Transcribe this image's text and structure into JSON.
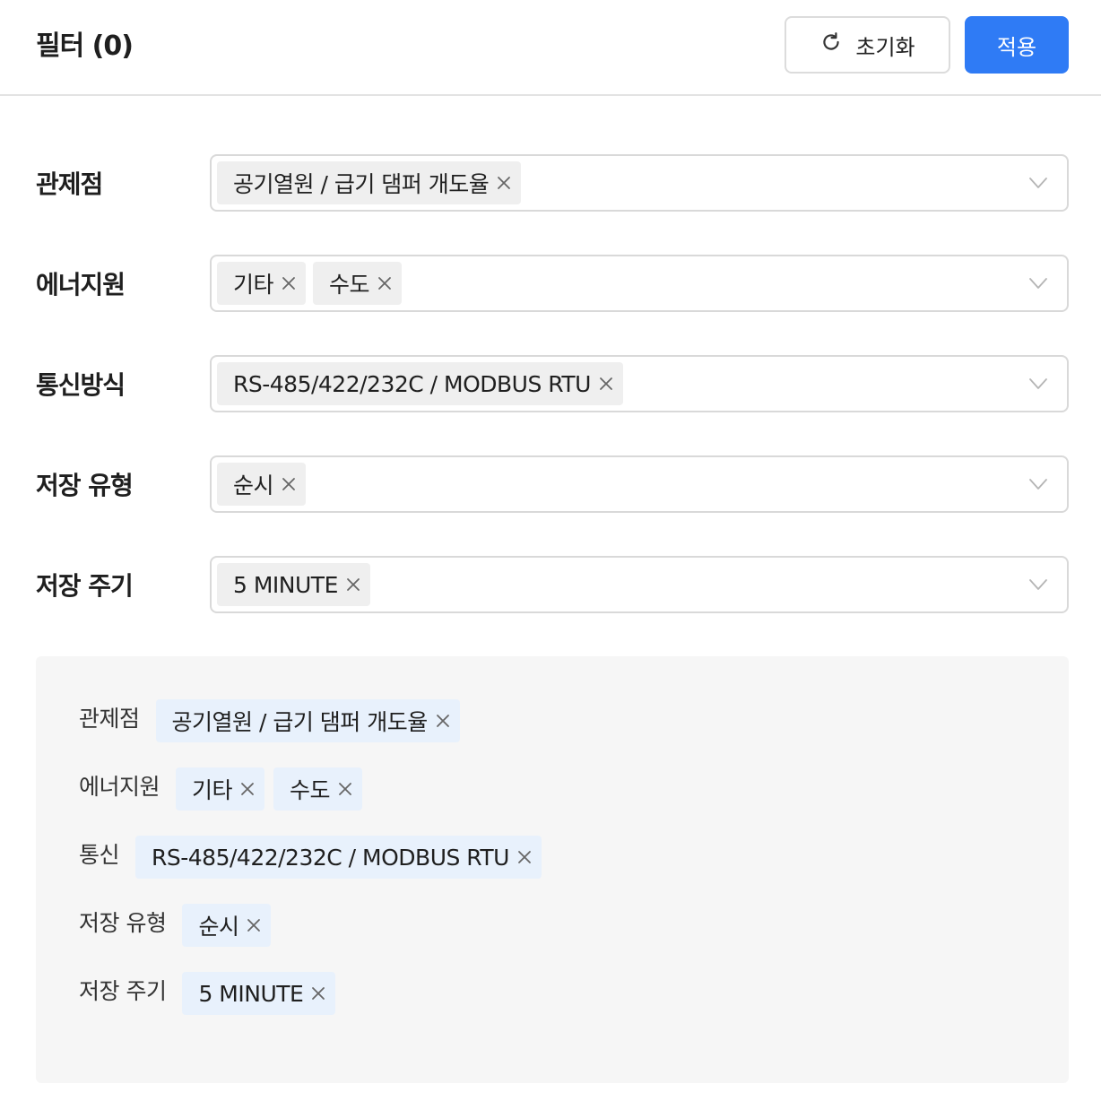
{
  "header": {
    "title": "필터 (0)",
    "reset_label": "초기화",
    "apply_label": "적용",
    "apply_color": "#2f7bf5"
  },
  "filters": [
    {
      "label": "관제점",
      "tags": [
        "공기열원 / 급기 댐퍼 개도율"
      ]
    },
    {
      "label": "에너지원",
      "tags": [
        "기타",
        "수도"
      ]
    },
    {
      "label": "통신방식",
      "tags": [
        "RS-485/422/232C / MODBUS RTU"
      ]
    },
    {
      "label": "저장 유형",
      "tags": [
        "순시"
      ]
    },
    {
      "label": "저장 주기",
      "tags": [
        "5 MINUTE"
      ]
    }
  ],
  "summary": [
    {
      "label": "관제점",
      "tags": [
        "공기열원 / 급기 댐퍼 개도율"
      ]
    },
    {
      "label": "에너지원",
      "tags": [
        "기타",
        "수도"
      ]
    },
    {
      "label": "통신",
      "tags": [
        "RS-485/422/232C / MODBUS RTU"
      ]
    },
    {
      "label": "저장 유형",
      "tags": [
        "순시"
      ]
    },
    {
      "label": "저장 주기",
      "tags": [
        "5 MINUTE"
      ]
    }
  ],
  "icons": {
    "reset": "refresh-icon",
    "remove": "close-icon",
    "dropdown": "chevron-down-icon"
  }
}
